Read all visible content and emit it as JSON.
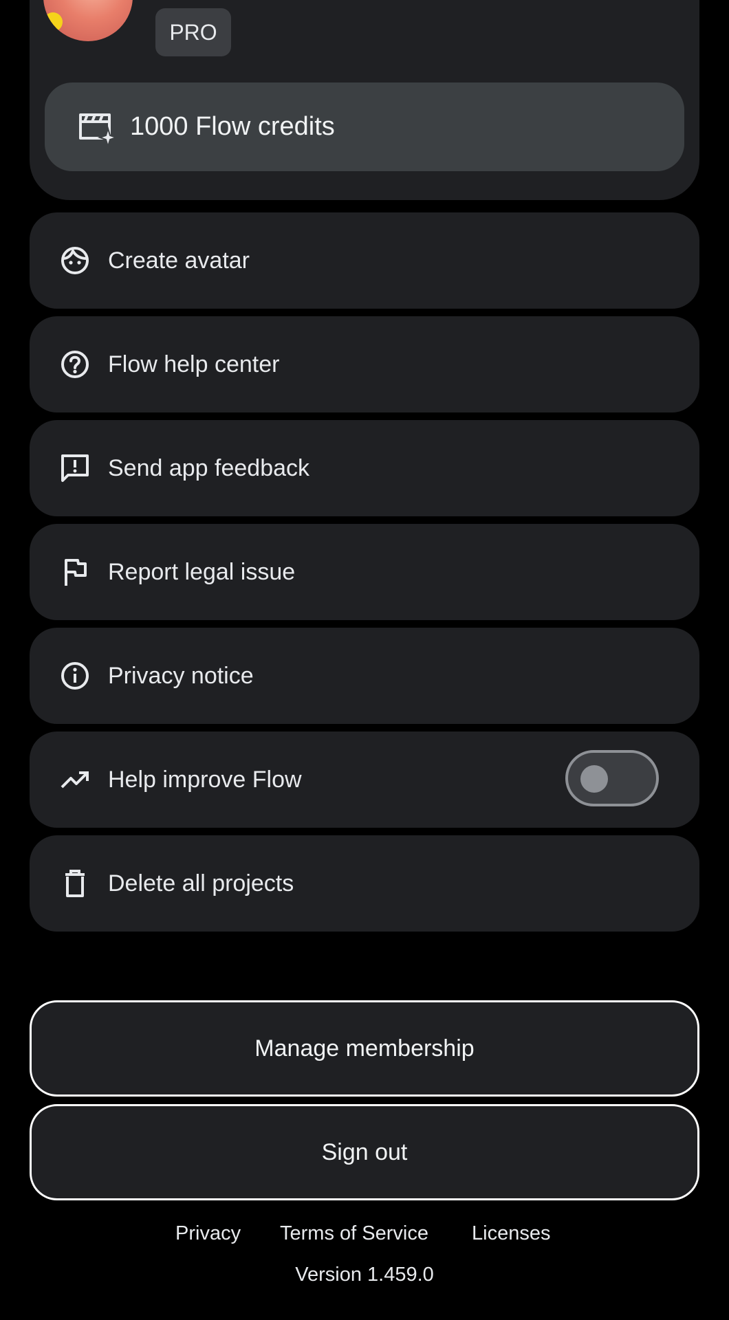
{
  "profile": {
    "badge": "PRO",
    "credits_label": "1000 Flow credits",
    "avatar_icon": "user-avatar-photo",
    "credits_icon": "clapperboard-sparkle-icon"
  },
  "menu": {
    "items": [
      {
        "label": "Create avatar",
        "icon": "face-icon"
      },
      {
        "label": "Flow help center",
        "icon": "help-circle-icon"
      },
      {
        "label": "Send app feedback",
        "icon": "feedback-icon"
      },
      {
        "label": "Report legal issue",
        "icon": "flag-icon"
      },
      {
        "label": "Privacy notice",
        "icon": "info-icon"
      },
      {
        "label": "Help improve Flow",
        "icon": "trending-up-icon",
        "toggle_on": false
      },
      {
        "label": "Delete all projects",
        "icon": "trash-icon"
      }
    ]
  },
  "actions": {
    "manage_membership": "Manage membership",
    "sign_out": "Sign out"
  },
  "footer": {
    "privacy": "Privacy",
    "terms": "Terms of Service",
    "licenses": "Licenses",
    "version": "Version 1.459.0"
  },
  "colors": {
    "background": "#000000",
    "card": "#1f2023",
    "pill": "#3c4043",
    "text": "#e8eaed",
    "toggle_off": "#8e9196"
  }
}
